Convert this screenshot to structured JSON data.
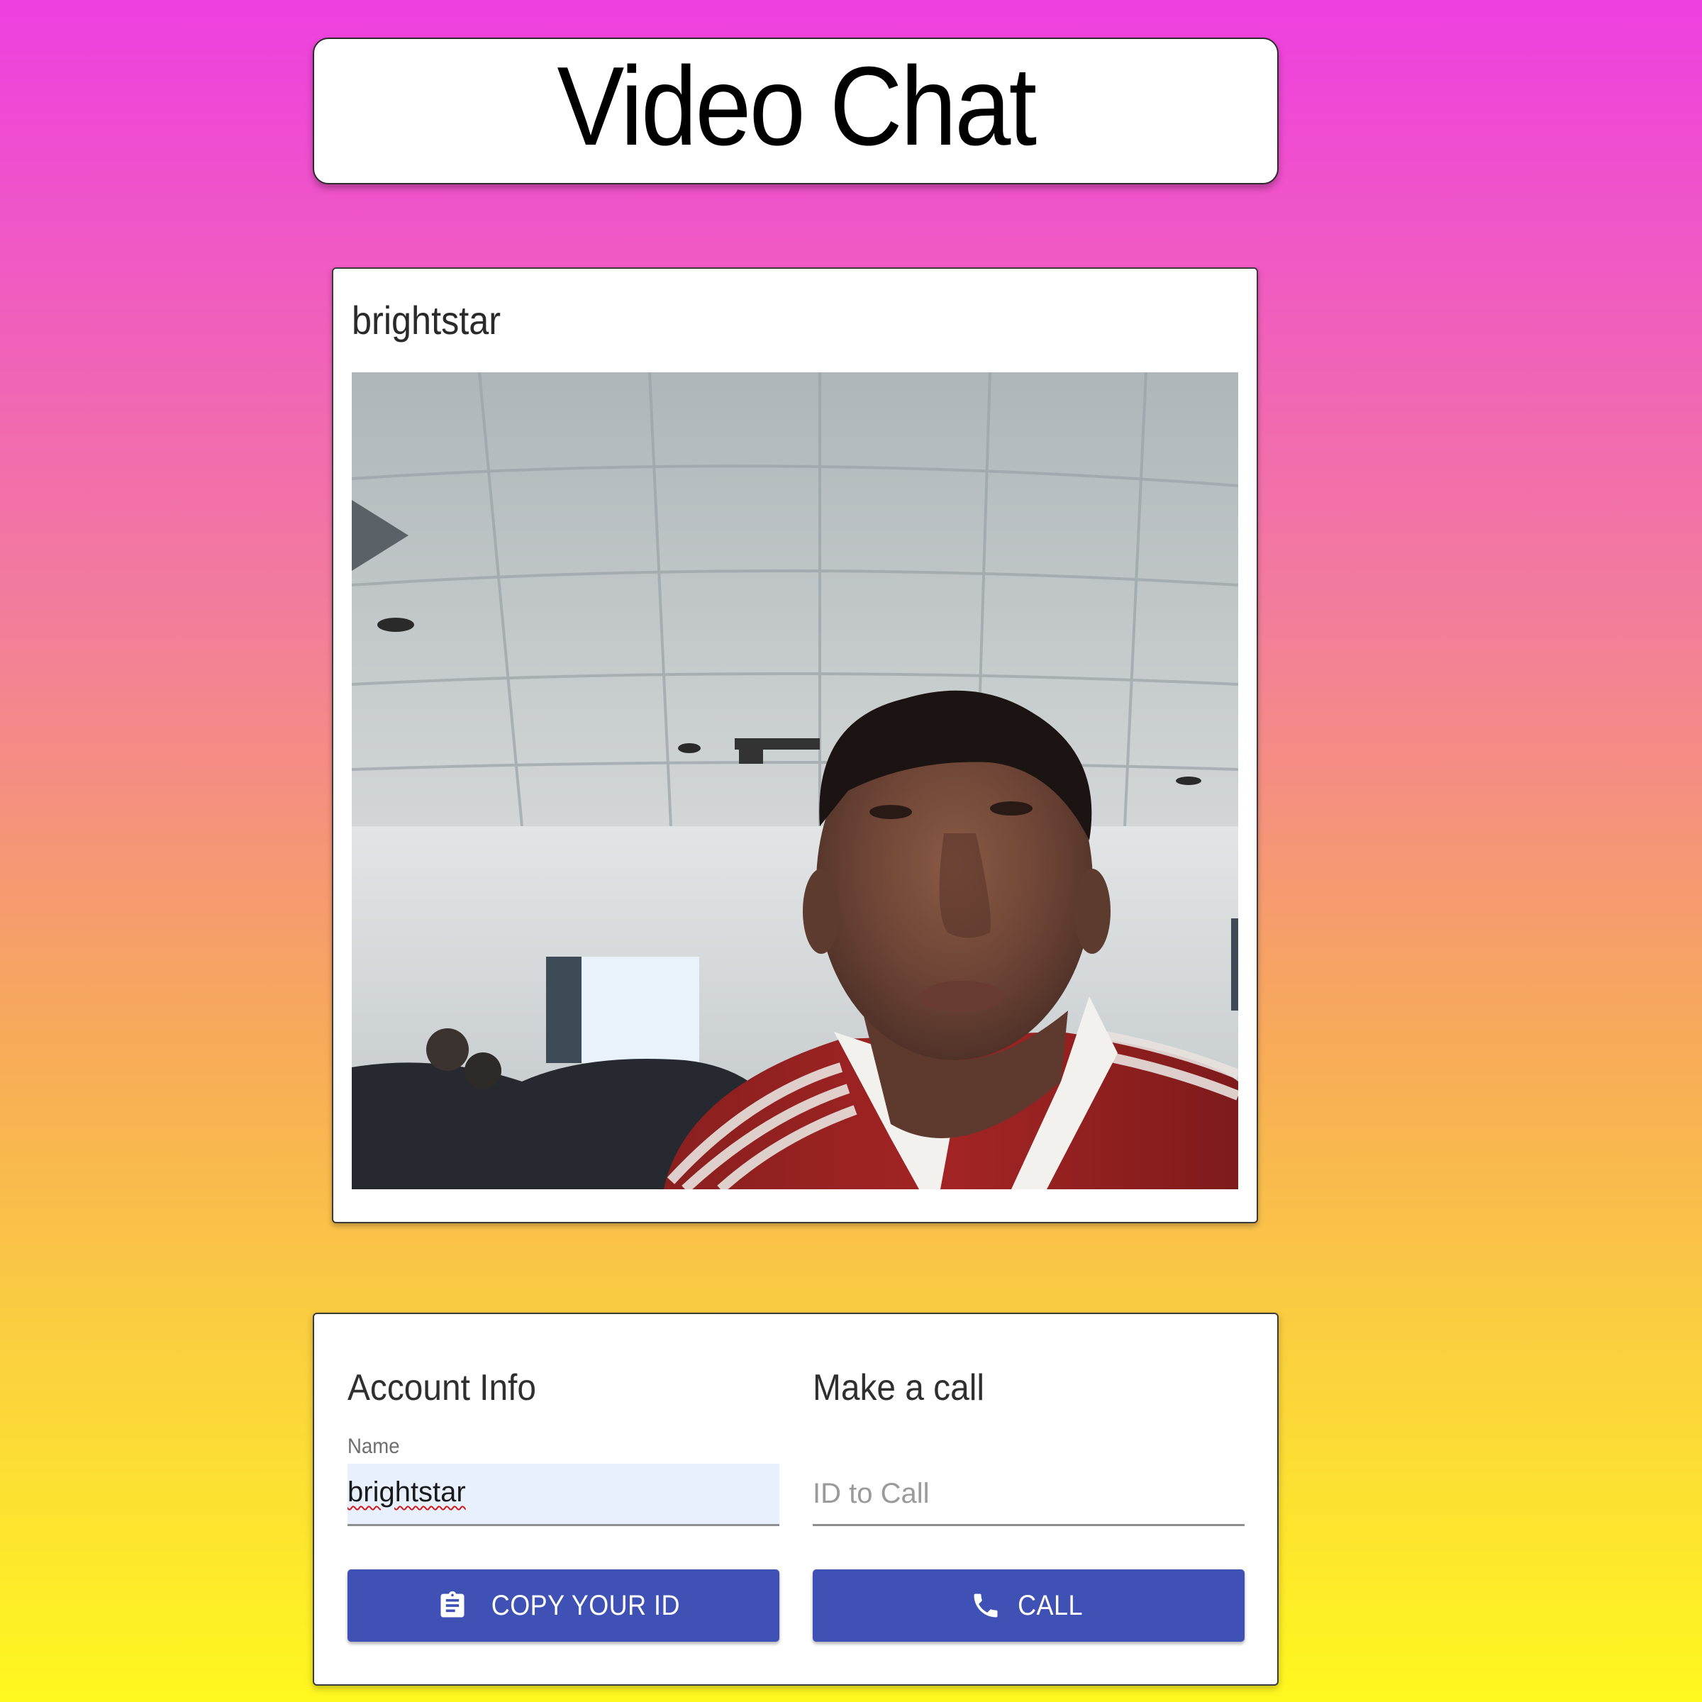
{
  "header": {
    "title": "Video Chat"
  },
  "video": {
    "name": "brightstar"
  },
  "account": {
    "heading": "Account Info",
    "name_label": "Name",
    "name_value": "brightstar",
    "copy_button_label": "COPY YOUR ID",
    "copy_icon": "clipboard-icon"
  },
  "call": {
    "heading": "Make a call",
    "id_placeholder": "ID to Call",
    "id_value": "",
    "call_button_label": "CALL",
    "call_icon": "phone-icon"
  },
  "colors": {
    "button": "#3f51b5",
    "gradient_top": "#ee3fe0",
    "gradient_bottom": "#fff81e",
    "autofill_bg": "#e8f0fe"
  }
}
